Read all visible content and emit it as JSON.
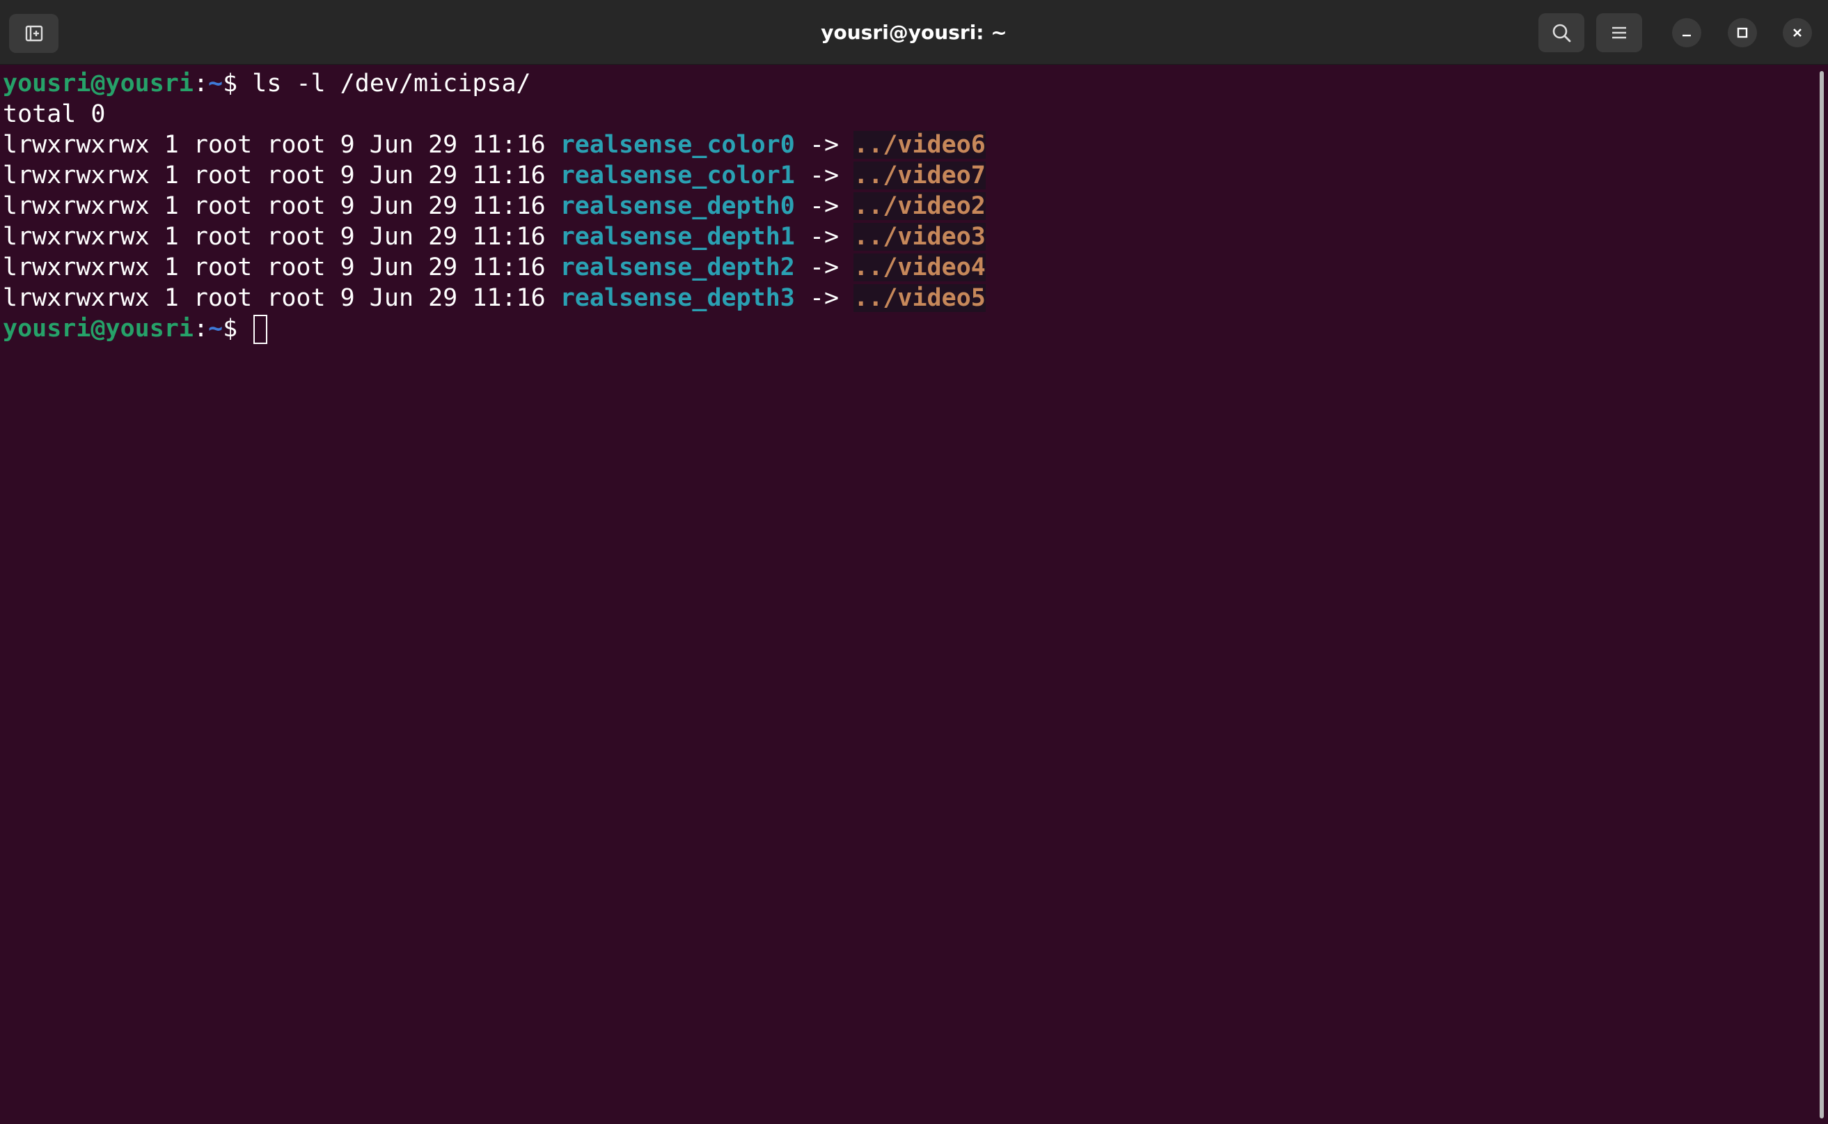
{
  "window": {
    "title": "yousri@yousri: ~"
  },
  "titlebar": {
    "icons": {
      "new_tab": "new-tab-icon",
      "search": "search-icon",
      "menu": "hamburger-menu-icon",
      "minimize": "minimize-icon",
      "maximize": "maximize-icon",
      "close": "close-icon"
    }
  },
  "terminal": {
    "prompt": {
      "user_host": "yousri@yousri",
      "colon": ":",
      "path": "~",
      "symbol": "$ "
    },
    "command": "ls -l /dev/micipsa/",
    "total_line": "total 0",
    "entries": [
      {
        "meta": "lrwxrwxrwx 1 root root 9 Jun 29 11:16 ",
        "name": "realsense_color0",
        "arrow": " -> ",
        "target": "../video6"
      },
      {
        "meta": "lrwxrwxrwx 1 root root 9 Jun 29 11:16 ",
        "name": "realsense_color1",
        "arrow": " -> ",
        "target": "../video7"
      },
      {
        "meta": "lrwxrwxrwx 1 root root 9 Jun 29 11:16 ",
        "name": "realsense_depth0",
        "arrow": " -> ",
        "target": "../video2"
      },
      {
        "meta": "lrwxrwxrwx 1 root root 9 Jun 29 11:16 ",
        "name": "realsense_depth1",
        "arrow": " -> ",
        "target": "../video3"
      },
      {
        "meta": "lrwxrwxrwx 1 root root 9 Jun 29 11:16 ",
        "name": "realsense_depth2",
        "arrow": " -> ",
        "target": "../video4"
      },
      {
        "meta": "lrwxrwxrwx 1 root root 9 Jun 29 11:16 ",
        "name": "realsense_depth3",
        "arrow": " -> ",
        "target": "../video5"
      }
    ]
  },
  "colors": {
    "background": "#300a24",
    "prompt_user": "#26a269",
    "prompt_path": "#3d7ad8",
    "link_name": "#2aa1b3",
    "link_target": "#c7885a"
  }
}
